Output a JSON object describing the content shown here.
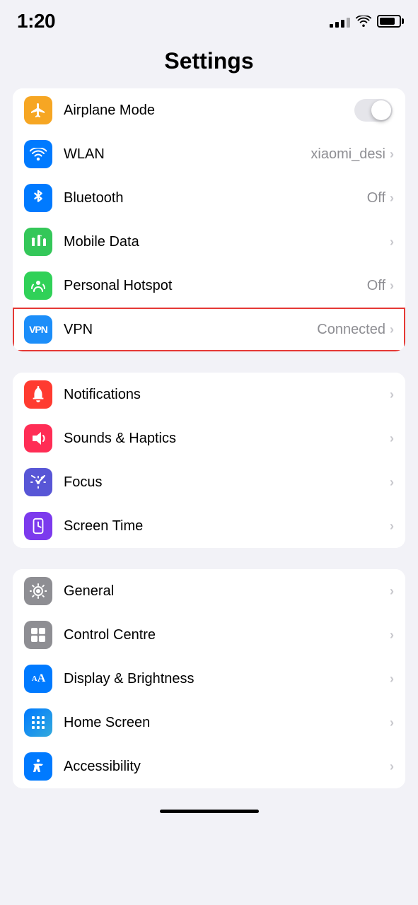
{
  "statusBar": {
    "time": "1:20"
  },
  "pageTitle": "Settings",
  "groups": [
    {
      "id": "connectivity",
      "items": [
        {
          "id": "airplane-mode",
          "icon": "✈",
          "iconBg": "bg-orange",
          "label": "Airplane Mode",
          "value": "",
          "hasToggle": true,
          "toggleOn": false,
          "hasChevron": false,
          "highlighted": false
        },
        {
          "id": "wlan",
          "icon": "wifi",
          "iconBg": "bg-blue",
          "label": "WLAN",
          "value": "xiaomi_desi",
          "hasToggle": false,
          "hasChevron": true,
          "highlighted": false
        },
        {
          "id": "bluetooth",
          "icon": "bt",
          "iconBg": "bg-bluetooth",
          "label": "Bluetooth",
          "value": "Off",
          "hasToggle": false,
          "hasChevron": true,
          "highlighted": false
        },
        {
          "id": "mobile-data",
          "icon": "signal",
          "iconBg": "bg-green",
          "label": "Mobile Data",
          "value": "",
          "hasToggle": false,
          "hasChevron": true,
          "highlighted": false
        },
        {
          "id": "personal-hotspot",
          "icon": "hotspot",
          "iconBg": "bg-green2",
          "label": "Personal Hotspot",
          "value": "Off",
          "hasToggle": false,
          "hasChevron": true,
          "highlighted": false
        },
        {
          "id": "vpn",
          "icon": "VPN",
          "iconBg": "bg-vpn",
          "label": "VPN",
          "value": "Connected",
          "hasToggle": false,
          "hasChevron": true,
          "highlighted": true
        }
      ]
    },
    {
      "id": "notifications-sounds",
      "items": [
        {
          "id": "notifications",
          "icon": "bell",
          "iconBg": "bg-red",
          "label": "Notifications",
          "value": "",
          "hasToggle": false,
          "hasChevron": true,
          "highlighted": false
        },
        {
          "id": "sounds-haptics",
          "icon": "sound",
          "iconBg": "bg-pink",
          "label": "Sounds & Haptics",
          "value": "",
          "hasToggle": false,
          "hasChevron": true,
          "highlighted": false
        },
        {
          "id": "focus",
          "icon": "moon",
          "iconBg": "bg-indigo",
          "label": "Focus",
          "value": "",
          "hasToggle": false,
          "hasChevron": true,
          "highlighted": false
        },
        {
          "id": "screen-time",
          "icon": "hourglass",
          "iconBg": "bg-purple",
          "label": "Screen Time",
          "value": "",
          "hasToggle": false,
          "hasChevron": true,
          "highlighted": false
        }
      ]
    },
    {
      "id": "general-settings",
      "items": [
        {
          "id": "general",
          "icon": "gear",
          "iconBg": "bg-gray",
          "label": "General",
          "value": "",
          "hasToggle": false,
          "hasChevron": true,
          "highlighted": false
        },
        {
          "id": "control-centre",
          "icon": "toggle",
          "iconBg": "bg-gray",
          "label": "Control Centre",
          "value": "",
          "hasToggle": false,
          "hasChevron": true,
          "highlighted": false
        },
        {
          "id": "display-brightness",
          "icon": "AA",
          "iconBg": "bg-aa",
          "label": "Display & Brightness",
          "value": "",
          "hasToggle": false,
          "hasChevron": true,
          "highlighted": false
        },
        {
          "id": "home-screen",
          "icon": "home",
          "iconBg": "bg-home",
          "label": "Home Screen",
          "value": "",
          "hasToggle": false,
          "hasChevron": true,
          "highlighted": false
        },
        {
          "id": "accessibility",
          "icon": "person",
          "iconBg": "bg-access",
          "label": "Accessibility",
          "value": "",
          "hasToggle": false,
          "hasChevron": true,
          "highlighted": false
        }
      ]
    }
  ]
}
